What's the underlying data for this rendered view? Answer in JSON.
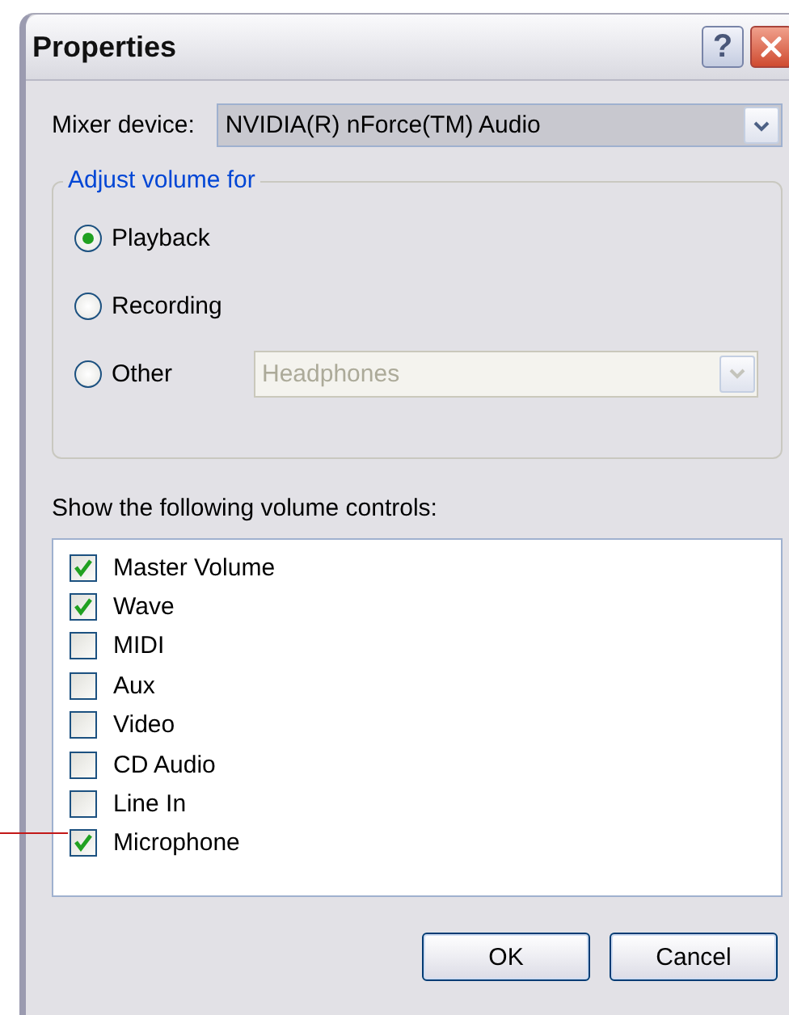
{
  "window": {
    "title": "Properties",
    "help_button": "?"
  },
  "mixer_device": {
    "label": "Mixer device:",
    "value": "NVIDIA(R) nForce(TM) Audio"
  },
  "adjust_volume": {
    "title": "Adjust volume for",
    "options": [
      {
        "label": "Playback",
        "selected": true
      },
      {
        "label": "Recording",
        "selected": false
      },
      {
        "label": "Other",
        "selected": false,
        "device": "Headphones",
        "device_disabled": true
      }
    ]
  },
  "volume_controls": {
    "label": "Show the following volume controls:",
    "items": [
      {
        "label": "Master Volume",
        "checked": true
      },
      {
        "label": "Wave",
        "checked": true
      },
      {
        "label": "MIDI",
        "checked": false
      },
      {
        "label": "Aux",
        "checked": false
      },
      {
        "label": "Video",
        "checked": false
      },
      {
        "label": "CD Audio",
        "checked": false
      },
      {
        "label": "Line In",
        "checked": false
      },
      {
        "label": "Microphone",
        "checked": true
      }
    ]
  },
  "buttons": [
    {
      "label": "OK"
    },
    {
      "label": "Cancel"
    }
  ]
}
